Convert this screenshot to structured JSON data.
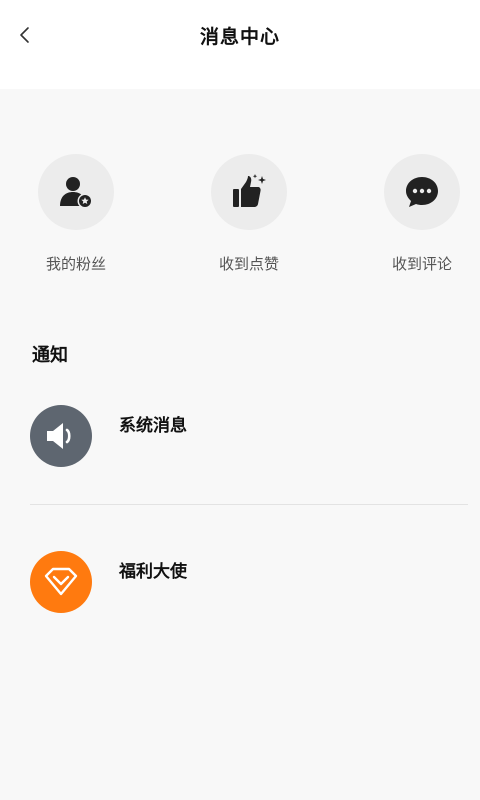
{
  "header": {
    "title": "消息中心",
    "back_icon": "chevron-left-icon"
  },
  "quick_actions": [
    {
      "label": "我的粉丝",
      "icon": "fans-icon"
    },
    {
      "label": "收到点赞",
      "icon": "thumbs-up-icon"
    },
    {
      "label": "收到评论",
      "icon": "comment-icon"
    }
  ],
  "notifications": {
    "section_title": "通知",
    "items": [
      {
        "label": "系统消息",
        "icon": "speaker-icon",
        "color": "#5e6670"
      },
      {
        "label": "福利大使",
        "icon": "diamond-icon",
        "color": "#ff7a0f"
      }
    ]
  }
}
